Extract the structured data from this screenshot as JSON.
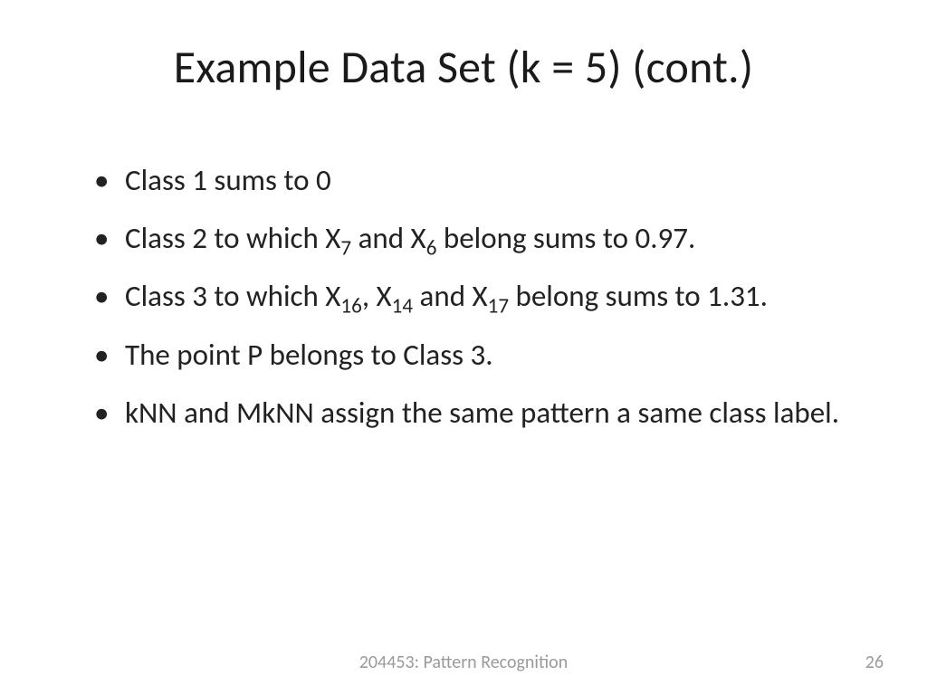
{
  "title": "Example Data Set (k = 5) (cont.)",
  "bullets": {
    "b1": "Class 1 sums to 0",
    "b2_pre": "Class 2 to which X",
    "b2_sub1": "7",
    "b2_mid": " and X",
    "b2_sub2": "6",
    "b2_post": " belong sums to 0.97.",
    "b3_pre": "Class 3 to which X",
    "b3_sub1": "16",
    "b3_mid1": ", X",
    "b3_sub2": "14",
    "b3_mid2": " and X",
    "b3_sub3": "17",
    "b3_post": " belong sums to 1.31.",
    "b4": "The point P belongs to Class 3.",
    "b5": "kNN and MkNN  assign the same pattern a same class label."
  },
  "footer": {
    "course": "204453: Pattern Recognition",
    "page": "26"
  }
}
